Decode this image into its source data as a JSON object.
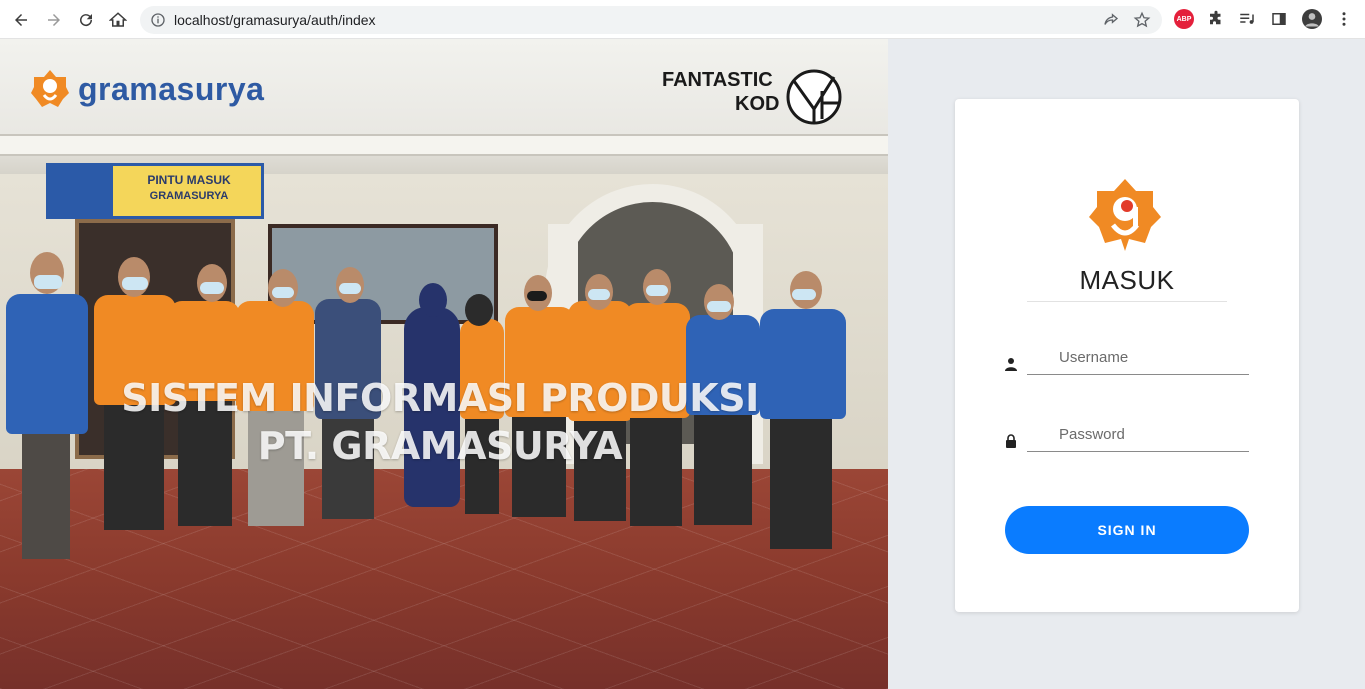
{
  "browser": {
    "url": "localhost/gramasurya/auth/index",
    "extensions": {
      "abp_label": "ABP"
    }
  },
  "hero": {
    "brand_name": "gramasurya",
    "partner_line1": "FANTASTIC",
    "partner_line2": "KOD",
    "sign_title": "GRAMASURYA",
    "sign_subtitle": "PINTU MASUK",
    "title_line1": "SISTEM INFORMASI PRODUKSI",
    "title_line2": "PT. GRAMASURYA"
  },
  "login": {
    "title": "MASUK",
    "username_placeholder": "Username",
    "password_placeholder": "Password",
    "signin_label": "SIGN IN"
  },
  "colors": {
    "accent": "#0a7cff",
    "brand_blue": "#2e5aa3",
    "brand_orange": "#f08a24"
  }
}
